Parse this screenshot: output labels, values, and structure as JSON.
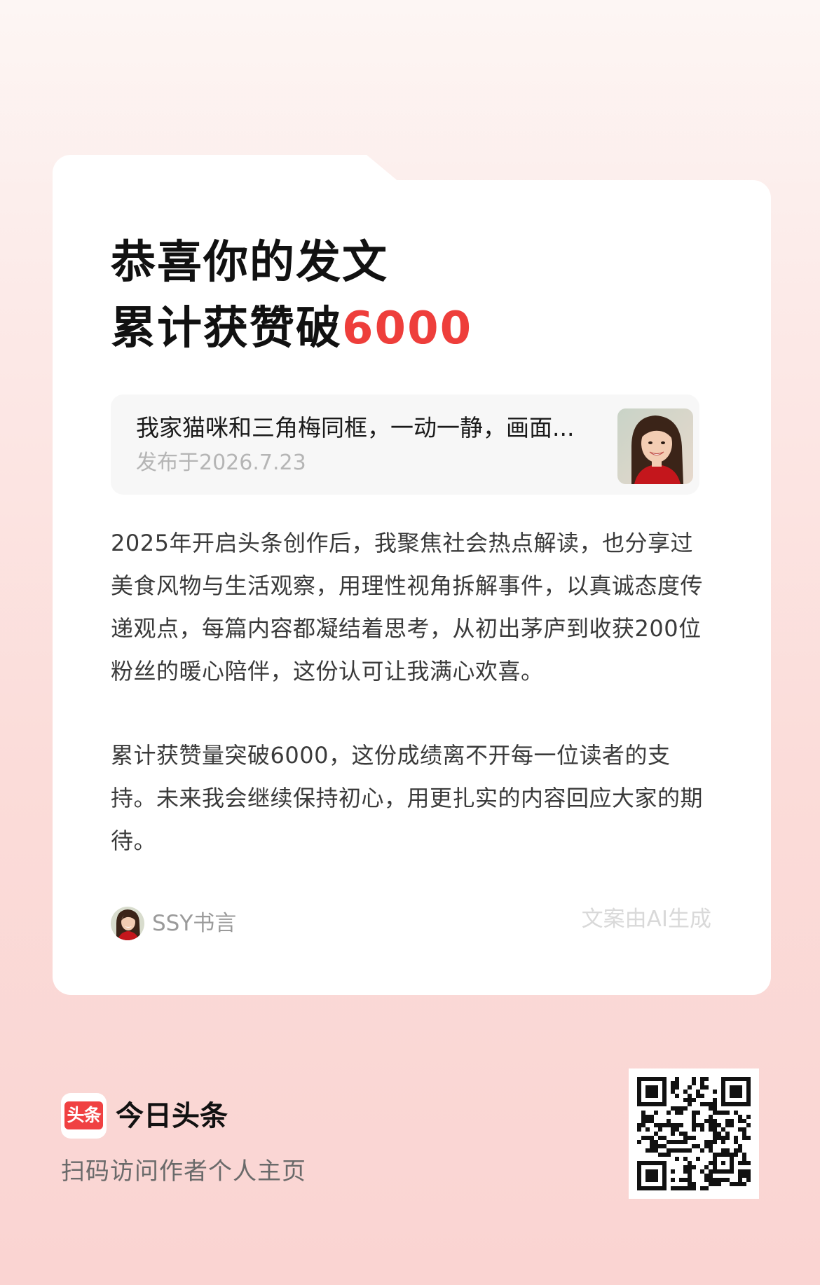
{
  "headline": {
    "line1": "恭喜你的发文",
    "line2_prefix": "累计获赞破",
    "line2_number": "6000"
  },
  "article": {
    "title": "我家猫咪和三角梅同框，一动一静，画面...",
    "date": "发布于2026.7.23",
    "thumbnail_icon": "portrait-thumbnail"
  },
  "body": {
    "paragraph1": "2025年开启头条创作后，我聚焦社会热点解读，也分享过美食风物与生活观察，用理性视角拆解事件，以真诚态度传递观点，每篇内容都凝结着思考，从初出茅庐到收获200位粉丝的暖心陪伴，这份认可让我满心欢喜。",
    "paragraph2": "累计获赞量突破6000，这份成绩离不开每一位读者的支持。未来我会继续保持初心，用更扎实的内容回应大家的期待。"
  },
  "author": {
    "name": "SSY书言",
    "avatar_icon": "author-avatar"
  },
  "ai_note": "文案由AI生成",
  "brand": {
    "logo_text": "头条",
    "app_name": "今日头条",
    "scan_hint": "扫码访问作者个人主页",
    "qr_icon": "qr-code"
  },
  "colors": {
    "accent": "#ee3e3b",
    "logo_red": "#f04142",
    "background_top": "#fdf6f4",
    "background_bottom": "#fad4d2"
  }
}
